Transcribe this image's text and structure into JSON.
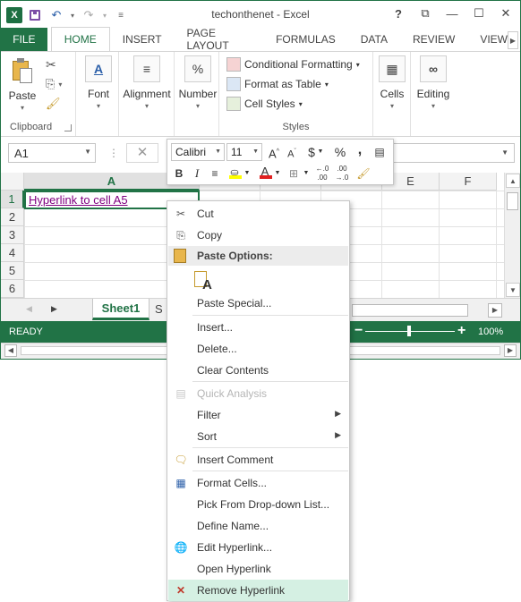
{
  "window": {
    "title": "techonthenet - Excel",
    "controls": [
      "?",
      "⧉",
      "—",
      "☐",
      "✕"
    ]
  },
  "qat": {
    "undo_icon": "↶",
    "redo_icon": "↷",
    "caret": "▾",
    "customize_icon": "≡"
  },
  "ribbon_tabs": [
    "FILE",
    "HOME",
    "INSERT",
    "PAGE LAYOUT",
    "FORMULAS",
    "DATA",
    "REVIEW",
    "VIEW"
  ],
  "ribbon": {
    "clipboard": {
      "paste": "Paste",
      "label": "Clipboard"
    },
    "font": {
      "label": "Font"
    },
    "alignment": {
      "label": "Alignment"
    },
    "number": {
      "label": "Number"
    },
    "styles": {
      "conditional_formatting": "Conditional Formatting",
      "format_as_table": "Format as Table",
      "cell_styles": "Cell Styles",
      "label": "Styles"
    },
    "cells": {
      "label": "Cells"
    },
    "editing": {
      "label": "Editing"
    }
  },
  "formula_bar": {
    "name_box": "A1",
    "dots": "⋮",
    "cancel_icon": "✕"
  },
  "grid": {
    "columns": [
      "A",
      "",
      "",
      "",
      "E",
      "F"
    ],
    "rows": [
      "1",
      "2",
      "3",
      "4",
      "5",
      "6"
    ],
    "a1_value": "Hyperlink to cell A5"
  },
  "sheets": {
    "active": "Sheet1",
    "next_partial": "S"
  },
  "status": {
    "text": "READY",
    "zoom": "100%",
    "zoom_level": 0.5
  },
  "mini_toolbar": {
    "font_name": "Calibri",
    "font_size": "11",
    "grow_font": "A",
    "shrink_font": "A",
    "currency": "$",
    "percent": "%",
    "comma": ",",
    "bold": "B",
    "italic": "I",
    "font_color_letter": "A"
  },
  "context_menu": {
    "cut": "Cut",
    "copy": "Copy",
    "paste_options": "Paste Options:",
    "paste_special": "Paste Special...",
    "insert": "Insert...",
    "delete": "Delete...",
    "clear_contents": "Clear Contents",
    "quick_analysis": "Quick Analysis",
    "filter": "Filter",
    "sort": "Sort",
    "insert_comment": "Insert Comment",
    "format_cells": "Format Cells...",
    "pick_list": "Pick From Drop-down List...",
    "define_name": "Define Name...",
    "edit_hyperlink": "Edit Hyperlink...",
    "open_hyperlink": "Open Hyperlink",
    "remove_hyperlink": "Remove Hyperlink"
  },
  "colors": {
    "excel_green": "#217346",
    "hyperlink_visited": "#800080",
    "highlight": "#d5f0e3"
  }
}
